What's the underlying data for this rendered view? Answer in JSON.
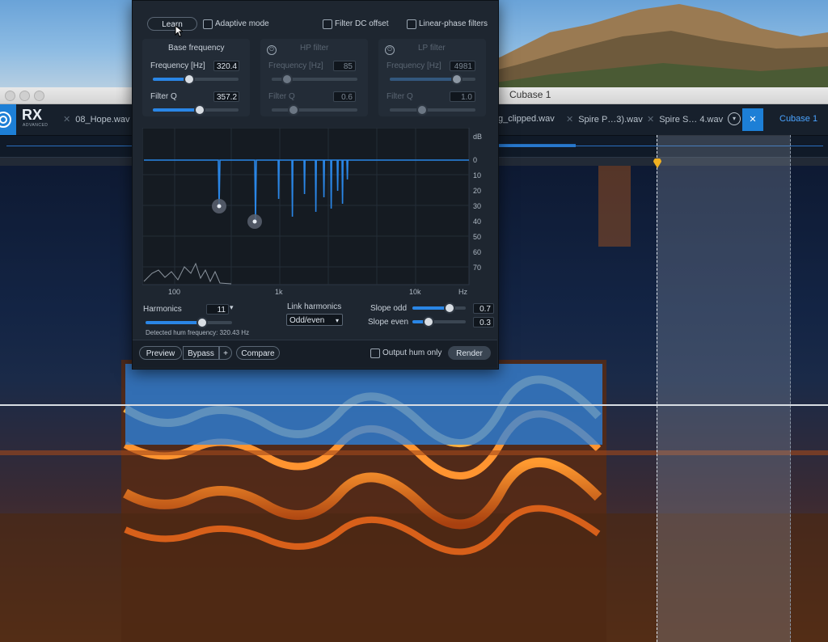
{
  "window": {
    "title": "Cubase 1"
  },
  "app": {
    "logo_text": "RX",
    "logo_sub": "ADVANCED"
  },
  "tabs": [
    {
      "label": "08_Hope.wav"
    },
    {
      "label": "g_clipped.wav"
    },
    {
      "label": "Spire P…3).wav"
    },
    {
      "label": "Spire S… 4.wav"
    },
    {
      "label": "Cubase 1"
    }
  ],
  "plugin": {
    "learn_label": "Learn",
    "adaptive_mode_label": "Adaptive mode",
    "filter_dc_label": "Filter DC offset",
    "linear_phase_label": "Linear-phase filters",
    "base": {
      "title": "Base frequency",
      "freq_label": "Frequency [Hz]",
      "freq_value": "320.4",
      "q_label": "Filter Q",
      "q_value": "357.2",
      "freq_level": 0.42,
      "q_level": 0.55
    },
    "hp": {
      "title": "HP filter",
      "freq_label": "Frequency [Hz]",
      "freq_value": "85",
      "q_label": "Filter Q",
      "q_value": "0.6",
      "freq_level": 0.18,
      "q_level": 0.25
    },
    "lp": {
      "title": "LP filter",
      "freq_label": "Frequency [Hz]",
      "freq_value": "4981",
      "q_label": "Filter Q",
      "q_value": "1.0",
      "freq_level": 0.78,
      "q_level": 0.38
    },
    "graph": {
      "y_unit": "dB",
      "y_ticks": [
        "0",
        "10",
        "20",
        "30",
        "40",
        "50",
        "60",
        "70"
      ],
      "x_ticks": [
        "100",
        "1k",
        "10k"
      ],
      "x_unit": "Hz"
    },
    "harmonics_label": "Harmonics",
    "harmonics_value": "11",
    "harmonics_level": 0.65,
    "detected_text": "Detected hum frequency: 320.43 Hz",
    "link_label": "Link harmonics",
    "link_value": "Odd/even",
    "slope_odd_label": "Slope odd",
    "slope_odd_value": "0.7",
    "slope_odd_level": 0.7,
    "slope_even_label": "Slope even",
    "slope_even_value": "0.3",
    "slope_even_level": 0.3,
    "preview_label": "Preview",
    "bypass_label": "Bypass",
    "plus_label": "+",
    "compare_label": "Compare",
    "output_hum_label": "Output hum only",
    "render_label": "Render"
  },
  "colors": {
    "accent": "#2a86e6",
    "marker": "#f0b020"
  }
}
